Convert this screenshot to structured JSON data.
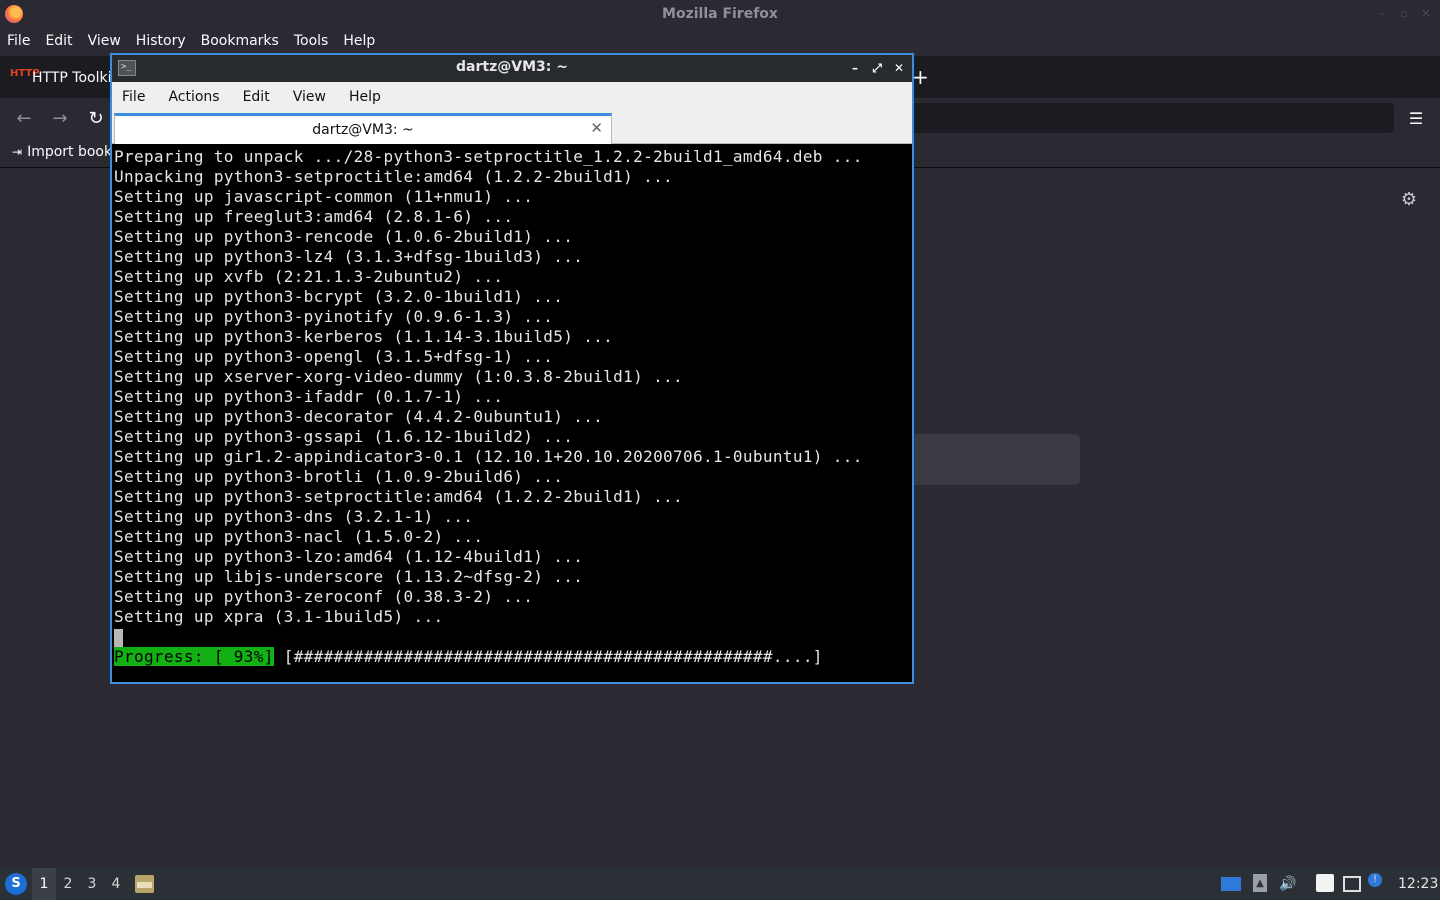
{
  "firefox": {
    "window_title": "Mozilla Firefox",
    "menu": [
      "File",
      "Edit",
      "View",
      "History",
      "Bookmarks",
      "Tools",
      "Help"
    ],
    "tab_label": "HTTP Toolkit",
    "tab_icon_text": "HTTP",
    "new_tab_symbol": "+",
    "bookmark_label": "Import book",
    "nav": {
      "back": "←",
      "forward": "→",
      "reload": "↻",
      "menu": "☰"
    },
    "settings_symbol": "⚙"
  },
  "terminal": {
    "title": "dartz@VM3: ~",
    "icon_text": ">_",
    "window_buttons": [
      "–",
      "⤢",
      "✕"
    ],
    "menu": [
      "File",
      "Actions",
      "Edit",
      "View",
      "Help"
    ],
    "tab_label": "dartz@VM3: ~",
    "tab_close": "✕",
    "lines": [
      "Preparing to unpack .../28-python3-setproctitle_1.2.2-2build1_amd64.deb ...",
      "Unpacking python3-setproctitle:amd64 (1.2.2-2build1) ...",
      "Setting up javascript-common (11+nmu1) ...",
      "Setting up freeglut3:amd64 (2.8.1-6) ...",
      "Setting up python3-rencode (1.0.6-2build1) ...",
      "Setting up python3-lz4 (3.1.3+dfsg-1build3) ...",
      "Setting up xvfb (2:21.1.3-2ubuntu2) ...",
      "Setting up python3-bcrypt (3.2.0-1build1) ...",
      "Setting up python3-pyinotify (0.9.6-1.3) ...",
      "Setting up python3-kerberos (1.1.14-3.1build5) ...",
      "Setting up python3-opengl (3.1.5+dfsg-1) ...",
      "Setting up xserver-xorg-video-dummy (1:0.3.8-2build1) ...",
      "Setting up python3-ifaddr (0.1.7-1) ...",
      "Setting up python3-decorator (4.4.2-0ubuntu1) ...",
      "Setting up python3-gssapi (1.6.12-1build2) ...",
      "Setting up gir1.2-appindicator3-0.1 (12.10.1+20.10.20200706.1-0ubuntu1) ...",
      "Setting up python3-brotli (1.0.9-2build6) ...",
      "Setting up python3-setproctitle:amd64 (1.2.2-2build1) ...",
      "Setting up python3-dns (3.2.1-1) ...",
      "Setting up python3-nacl (1.5.0-2) ...",
      "Setting up python3-lzo:amd64 (1.12-4build1) ...",
      "Setting up libjs-underscore (1.13.2~dfsg-2) ...",
      "Setting up python3-zeroconf (0.38.3-2) ...",
      "Setting up xpra (3.1-1build5) ..."
    ],
    "progress_label": "Progress: [ 93%]",
    "progress_bar": " [################################################....]",
    "progress_percent": 93
  },
  "taskbar": {
    "start_symbol": "S",
    "workspaces": [
      "1",
      "2",
      "3",
      "4"
    ],
    "active_workspace": "1",
    "clock": "12:23",
    "volume_symbol": "🔊",
    "notification_symbol": "!"
  }
}
